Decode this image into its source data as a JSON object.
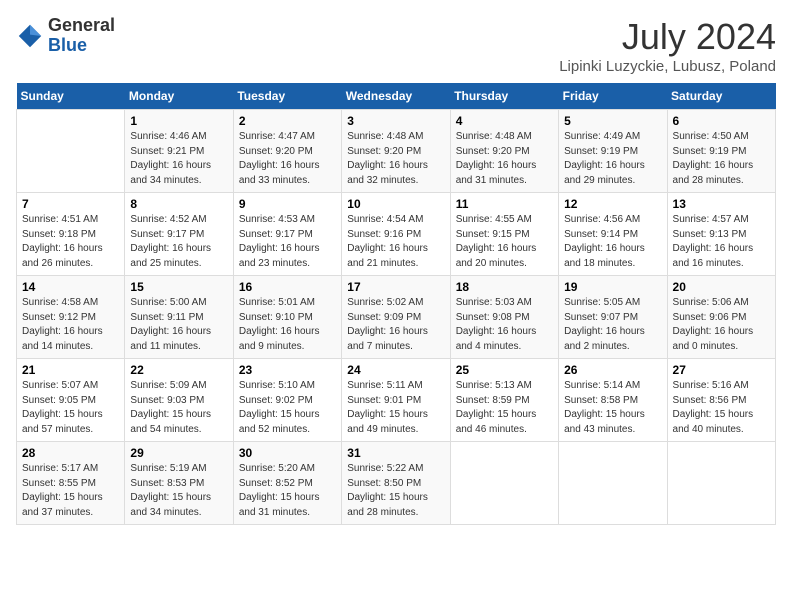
{
  "header": {
    "logo_general": "General",
    "logo_blue": "Blue",
    "month_year": "July 2024",
    "location": "Lipinki Luzyckie, Lubusz, Poland"
  },
  "weekdays": [
    "Sunday",
    "Monday",
    "Tuesday",
    "Wednesday",
    "Thursday",
    "Friday",
    "Saturday"
  ],
  "weeks": [
    [
      {
        "day": "",
        "sunrise": "",
        "sunset": "",
        "daylight": ""
      },
      {
        "day": "1",
        "sunrise": "Sunrise: 4:46 AM",
        "sunset": "Sunset: 9:21 PM",
        "daylight": "Daylight: 16 hours and 34 minutes."
      },
      {
        "day": "2",
        "sunrise": "Sunrise: 4:47 AM",
        "sunset": "Sunset: 9:20 PM",
        "daylight": "Daylight: 16 hours and 33 minutes."
      },
      {
        "day": "3",
        "sunrise": "Sunrise: 4:48 AM",
        "sunset": "Sunset: 9:20 PM",
        "daylight": "Daylight: 16 hours and 32 minutes."
      },
      {
        "day": "4",
        "sunrise": "Sunrise: 4:48 AM",
        "sunset": "Sunset: 9:20 PM",
        "daylight": "Daylight: 16 hours and 31 minutes."
      },
      {
        "day": "5",
        "sunrise": "Sunrise: 4:49 AM",
        "sunset": "Sunset: 9:19 PM",
        "daylight": "Daylight: 16 hours and 29 minutes."
      },
      {
        "day": "6",
        "sunrise": "Sunrise: 4:50 AM",
        "sunset": "Sunset: 9:19 PM",
        "daylight": "Daylight: 16 hours and 28 minutes."
      }
    ],
    [
      {
        "day": "7",
        "sunrise": "Sunrise: 4:51 AM",
        "sunset": "Sunset: 9:18 PM",
        "daylight": "Daylight: 16 hours and 26 minutes."
      },
      {
        "day": "8",
        "sunrise": "Sunrise: 4:52 AM",
        "sunset": "Sunset: 9:17 PM",
        "daylight": "Daylight: 16 hours and 25 minutes."
      },
      {
        "day": "9",
        "sunrise": "Sunrise: 4:53 AM",
        "sunset": "Sunset: 9:17 PM",
        "daylight": "Daylight: 16 hours and 23 minutes."
      },
      {
        "day": "10",
        "sunrise": "Sunrise: 4:54 AM",
        "sunset": "Sunset: 9:16 PM",
        "daylight": "Daylight: 16 hours and 21 minutes."
      },
      {
        "day": "11",
        "sunrise": "Sunrise: 4:55 AM",
        "sunset": "Sunset: 9:15 PM",
        "daylight": "Daylight: 16 hours and 20 minutes."
      },
      {
        "day": "12",
        "sunrise": "Sunrise: 4:56 AM",
        "sunset": "Sunset: 9:14 PM",
        "daylight": "Daylight: 16 hours and 18 minutes."
      },
      {
        "day": "13",
        "sunrise": "Sunrise: 4:57 AM",
        "sunset": "Sunset: 9:13 PM",
        "daylight": "Daylight: 16 hours and 16 minutes."
      }
    ],
    [
      {
        "day": "14",
        "sunrise": "Sunrise: 4:58 AM",
        "sunset": "Sunset: 9:12 PM",
        "daylight": "Daylight: 16 hours and 14 minutes."
      },
      {
        "day": "15",
        "sunrise": "Sunrise: 5:00 AM",
        "sunset": "Sunset: 9:11 PM",
        "daylight": "Daylight: 16 hours and 11 minutes."
      },
      {
        "day": "16",
        "sunrise": "Sunrise: 5:01 AM",
        "sunset": "Sunset: 9:10 PM",
        "daylight": "Daylight: 16 hours and 9 minutes."
      },
      {
        "day": "17",
        "sunrise": "Sunrise: 5:02 AM",
        "sunset": "Sunset: 9:09 PM",
        "daylight": "Daylight: 16 hours and 7 minutes."
      },
      {
        "day": "18",
        "sunrise": "Sunrise: 5:03 AM",
        "sunset": "Sunset: 9:08 PM",
        "daylight": "Daylight: 16 hours and 4 minutes."
      },
      {
        "day": "19",
        "sunrise": "Sunrise: 5:05 AM",
        "sunset": "Sunset: 9:07 PM",
        "daylight": "Daylight: 16 hours and 2 minutes."
      },
      {
        "day": "20",
        "sunrise": "Sunrise: 5:06 AM",
        "sunset": "Sunset: 9:06 PM",
        "daylight": "Daylight: 16 hours and 0 minutes."
      }
    ],
    [
      {
        "day": "21",
        "sunrise": "Sunrise: 5:07 AM",
        "sunset": "Sunset: 9:05 PM",
        "daylight": "Daylight: 15 hours and 57 minutes."
      },
      {
        "day": "22",
        "sunrise": "Sunrise: 5:09 AM",
        "sunset": "Sunset: 9:03 PM",
        "daylight": "Daylight: 15 hours and 54 minutes."
      },
      {
        "day": "23",
        "sunrise": "Sunrise: 5:10 AM",
        "sunset": "Sunset: 9:02 PM",
        "daylight": "Daylight: 15 hours and 52 minutes."
      },
      {
        "day": "24",
        "sunrise": "Sunrise: 5:11 AM",
        "sunset": "Sunset: 9:01 PM",
        "daylight": "Daylight: 15 hours and 49 minutes."
      },
      {
        "day": "25",
        "sunrise": "Sunrise: 5:13 AM",
        "sunset": "Sunset: 8:59 PM",
        "daylight": "Daylight: 15 hours and 46 minutes."
      },
      {
        "day": "26",
        "sunrise": "Sunrise: 5:14 AM",
        "sunset": "Sunset: 8:58 PM",
        "daylight": "Daylight: 15 hours and 43 minutes."
      },
      {
        "day": "27",
        "sunrise": "Sunrise: 5:16 AM",
        "sunset": "Sunset: 8:56 PM",
        "daylight": "Daylight: 15 hours and 40 minutes."
      }
    ],
    [
      {
        "day": "28",
        "sunrise": "Sunrise: 5:17 AM",
        "sunset": "Sunset: 8:55 PM",
        "daylight": "Daylight: 15 hours and 37 minutes."
      },
      {
        "day": "29",
        "sunrise": "Sunrise: 5:19 AM",
        "sunset": "Sunset: 8:53 PM",
        "daylight": "Daylight: 15 hours and 34 minutes."
      },
      {
        "day": "30",
        "sunrise": "Sunrise: 5:20 AM",
        "sunset": "Sunset: 8:52 PM",
        "daylight": "Daylight: 15 hours and 31 minutes."
      },
      {
        "day": "31",
        "sunrise": "Sunrise: 5:22 AM",
        "sunset": "Sunset: 8:50 PM",
        "daylight": "Daylight: 15 hours and 28 minutes."
      },
      {
        "day": "",
        "sunrise": "",
        "sunset": "",
        "daylight": ""
      },
      {
        "day": "",
        "sunrise": "",
        "sunset": "",
        "daylight": ""
      },
      {
        "day": "",
        "sunrise": "",
        "sunset": "",
        "daylight": ""
      }
    ]
  ]
}
